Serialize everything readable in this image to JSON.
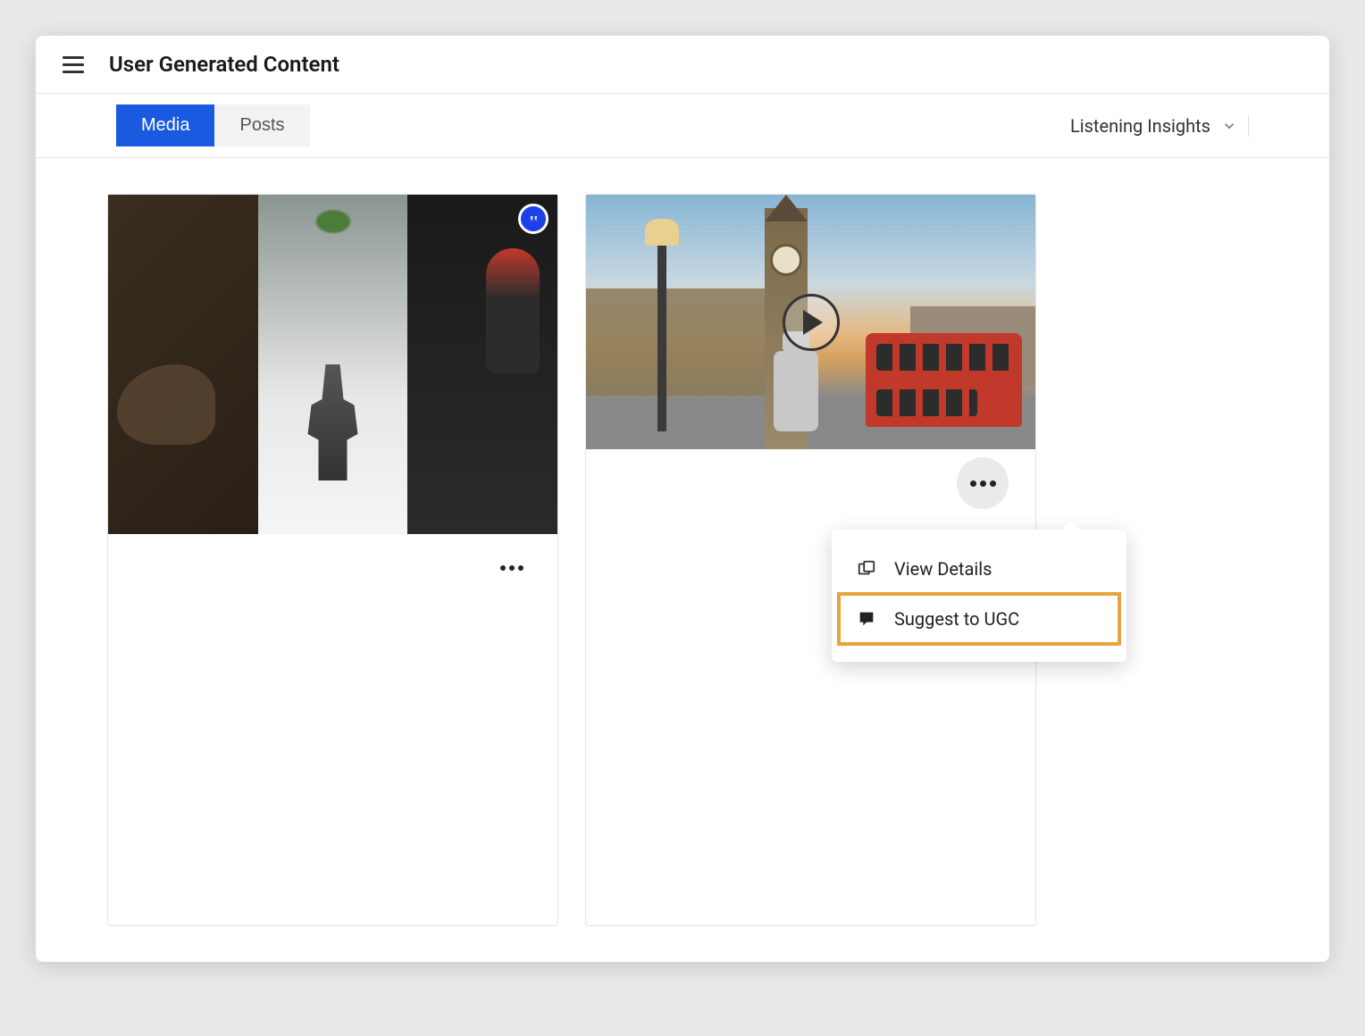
{
  "header": {
    "title": "User Generated Content"
  },
  "tabs": {
    "media": "Media",
    "posts": "Posts"
  },
  "toolbar": {
    "listening_insights": "Listening Insights"
  },
  "cards": [
    {
      "type": "image-carousel",
      "badge": "quote"
    },
    {
      "type": "video"
    }
  ],
  "dropdown": {
    "view_details": "View Details",
    "suggest_ugc": "Suggest to UGC"
  }
}
